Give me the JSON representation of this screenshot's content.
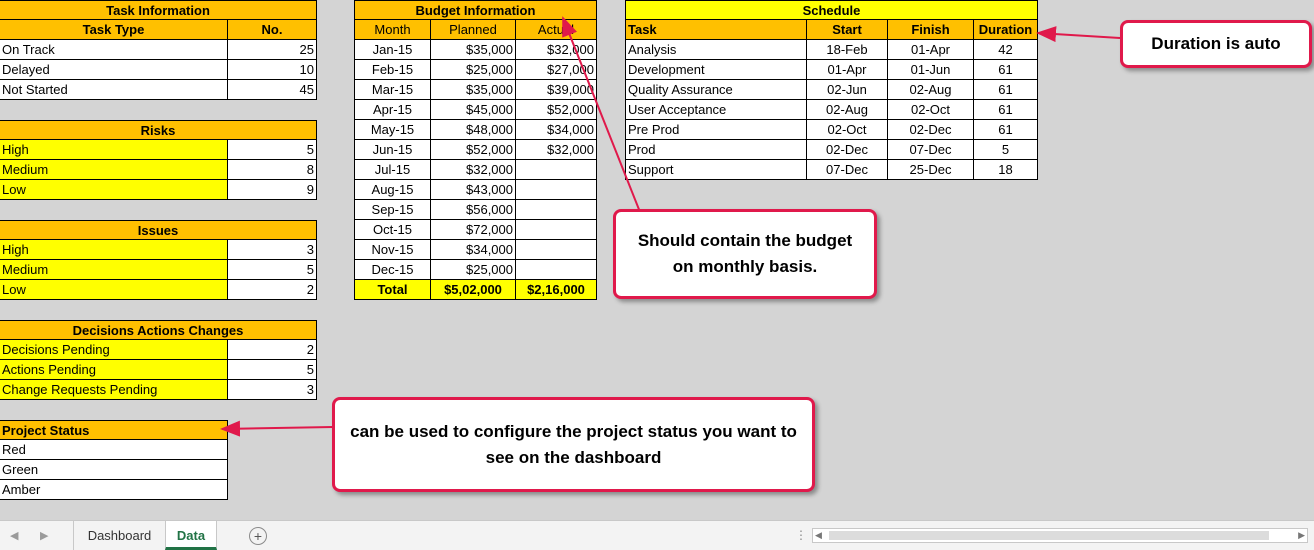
{
  "task_info": {
    "title": "Task  Information",
    "col_type": "Task Type",
    "col_no": "No.",
    "rows": [
      {
        "label": "On Track",
        "value": "25"
      },
      {
        "label": "Delayed",
        "value": "10"
      },
      {
        "label": "Not Started",
        "value": "45"
      }
    ]
  },
  "risks": {
    "title": "Risks",
    "rows": [
      {
        "label": "High",
        "value": "5"
      },
      {
        "label": "Medium",
        "value": "8"
      },
      {
        "label": "Low",
        "value": "9"
      }
    ]
  },
  "issues": {
    "title": "Issues",
    "rows": [
      {
        "label": "High",
        "value": "3"
      },
      {
        "label": "Medium",
        "value": "5"
      },
      {
        "label": "Low",
        "value": "2"
      }
    ]
  },
  "decisions": {
    "title": "Decisions Actions Changes",
    "rows": [
      {
        "label": "Decisions Pending",
        "value": "2"
      },
      {
        "label": "Actions Pending",
        "value": "5"
      },
      {
        "label": "Change Requests Pending",
        "value": "3"
      }
    ]
  },
  "project_status": {
    "title": "Project Status",
    "rows": [
      "Red",
      "Green",
      "Amber"
    ]
  },
  "budget": {
    "title": "Budget Information",
    "col_month": "Month",
    "col_planned": "Planned",
    "col_actual": "Actual",
    "rows": [
      {
        "month": "Jan-15",
        "planned": "$35,000",
        "actual": "$32,000"
      },
      {
        "month": "Feb-15",
        "planned": "$25,000",
        "actual": "$27,000"
      },
      {
        "month": "Mar-15",
        "planned": "$35,000",
        "actual": "$39,000"
      },
      {
        "month": "Apr-15",
        "planned": "$45,000",
        "actual": "$52,000"
      },
      {
        "month": "May-15",
        "planned": "$48,000",
        "actual": "$34,000"
      },
      {
        "month": "Jun-15",
        "planned": "$52,000",
        "actual": "$32,000"
      },
      {
        "month": "Jul-15",
        "planned": "$32,000",
        "actual": ""
      },
      {
        "month": "Aug-15",
        "planned": "$43,000",
        "actual": ""
      },
      {
        "month": "Sep-15",
        "planned": "$56,000",
        "actual": ""
      },
      {
        "month": "Oct-15",
        "planned": "$72,000",
        "actual": ""
      },
      {
        "month": "Nov-15",
        "planned": "$34,000",
        "actual": ""
      },
      {
        "month": "Dec-15",
        "planned": "$25,000",
        "actual": ""
      }
    ],
    "total_label": "Total",
    "total_planned": "$5,02,000",
    "total_actual": "$2,16,000"
  },
  "schedule": {
    "title": "Schedule",
    "col_task": "Task",
    "col_start": "Start",
    "col_finish": "Finish",
    "col_duration": "Duration",
    "rows": [
      {
        "task": "Analysis",
        "start": "18-Feb",
        "finish": "01-Apr",
        "duration": "42"
      },
      {
        "task": "Development",
        "start": "01-Apr",
        "finish": "01-Jun",
        "duration": "61"
      },
      {
        "task": "Quality Assurance",
        "start": "02-Jun",
        "finish": "02-Aug",
        "duration": "61"
      },
      {
        "task": "User Acceptance",
        "start": "02-Aug",
        "finish": "02-Oct",
        "duration": "61"
      },
      {
        "task": "Pre Prod",
        "start": "02-Oct",
        "finish": "02-Dec",
        "duration": "61"
      },
      {
        "task": "Prod",
        "start": "02-Dec",
        "finish": "07-Dec",
        "duration": "5"
      },
      {
        "task": "Support",
        "start": "07-Dec",
        "finish": "25-Dec",
        "duration": "18"
      }
    ]
  },
  "callouts": {
    "duration": "Duration is auto",
    "budget": "Should contain the budget on monthly basis.",
    "status": "can be used to configure the project status you want to see on the dashboard"
  },
  "tabs": {
    "dashboard": "Dashboard",
    "data": "Data",
    "add": "+"
  },
  "colors": {
    "header": "#ffc000",
    "highlight": "#ffff00",
    "callout_border": "#e0194b",
    "active_tab_text": "#217346"
  }
}
